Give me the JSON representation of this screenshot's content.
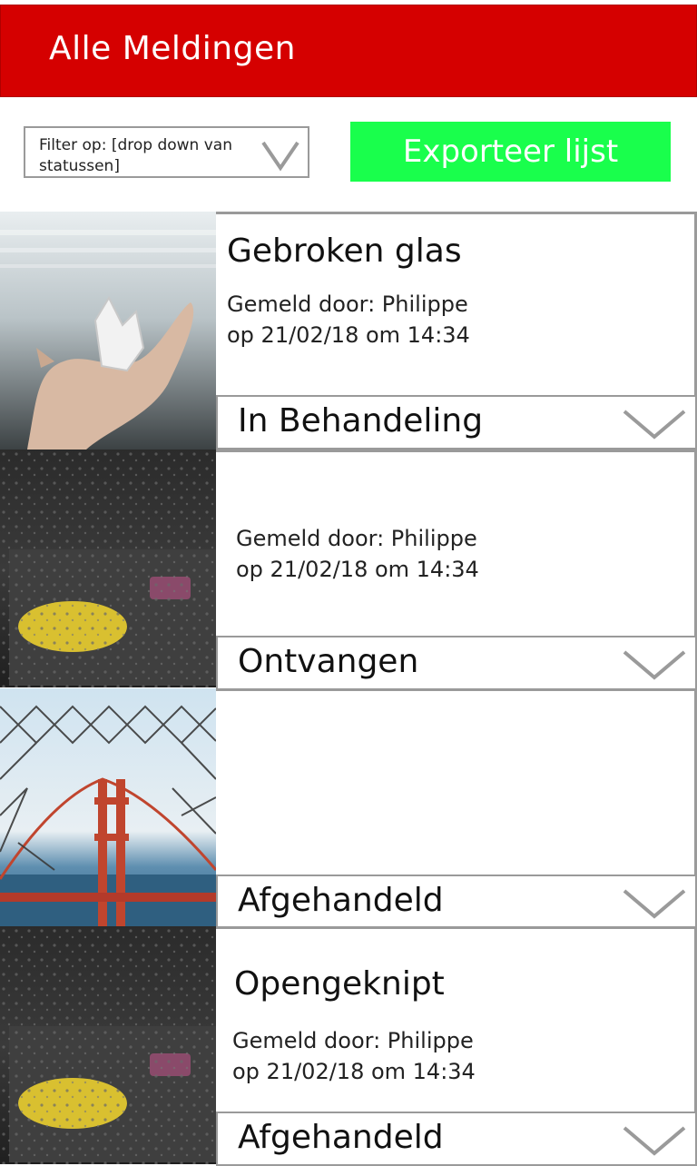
{
  "header": {
    "title": "Alle Meldingen"
  },
  "filter": {
    "label": "Filter op: [drop down van statussen]",
    "icon": "chevron-down-icon"
  },
  "export": {
    "label": "Exporteer lijst"
  },
  "colors": {
    "header_bg": "#d50000",
    "export_bg": "#19ff4c",
    "border": "#9a9a9a"
  },
  "items": [
    {
      "title": "Gebroken glas",
      "reporter": "Gemeld door: Philippe",
      "date": "op 21/02/18 om 14:34",
      "status": "In Behandeling",
      "image": "hand-with-crystal-photo"
    },
    {
      "title": "",
      "reporter": "Gemeld door: Philippe",
      "date": "op 21/02/18 om 14:34",
      "status": "Ontvangen",
      "image": "rainy-window-photo"
    },
    {
      "title": "",
      "reporter": "",
      "date": "",
      "status": "Afgehandeld",
      "image": "golden-gate-fence-photo"
    },
    {
      "title": "Opengeknipt",
      "reporter": "Gemeld door: Philippe",
      "date": "op 21/02/18 om 14:34",
      "status": "Afgehandeld",
      "image": "rainy-window-photo"
    }
  ]
}
